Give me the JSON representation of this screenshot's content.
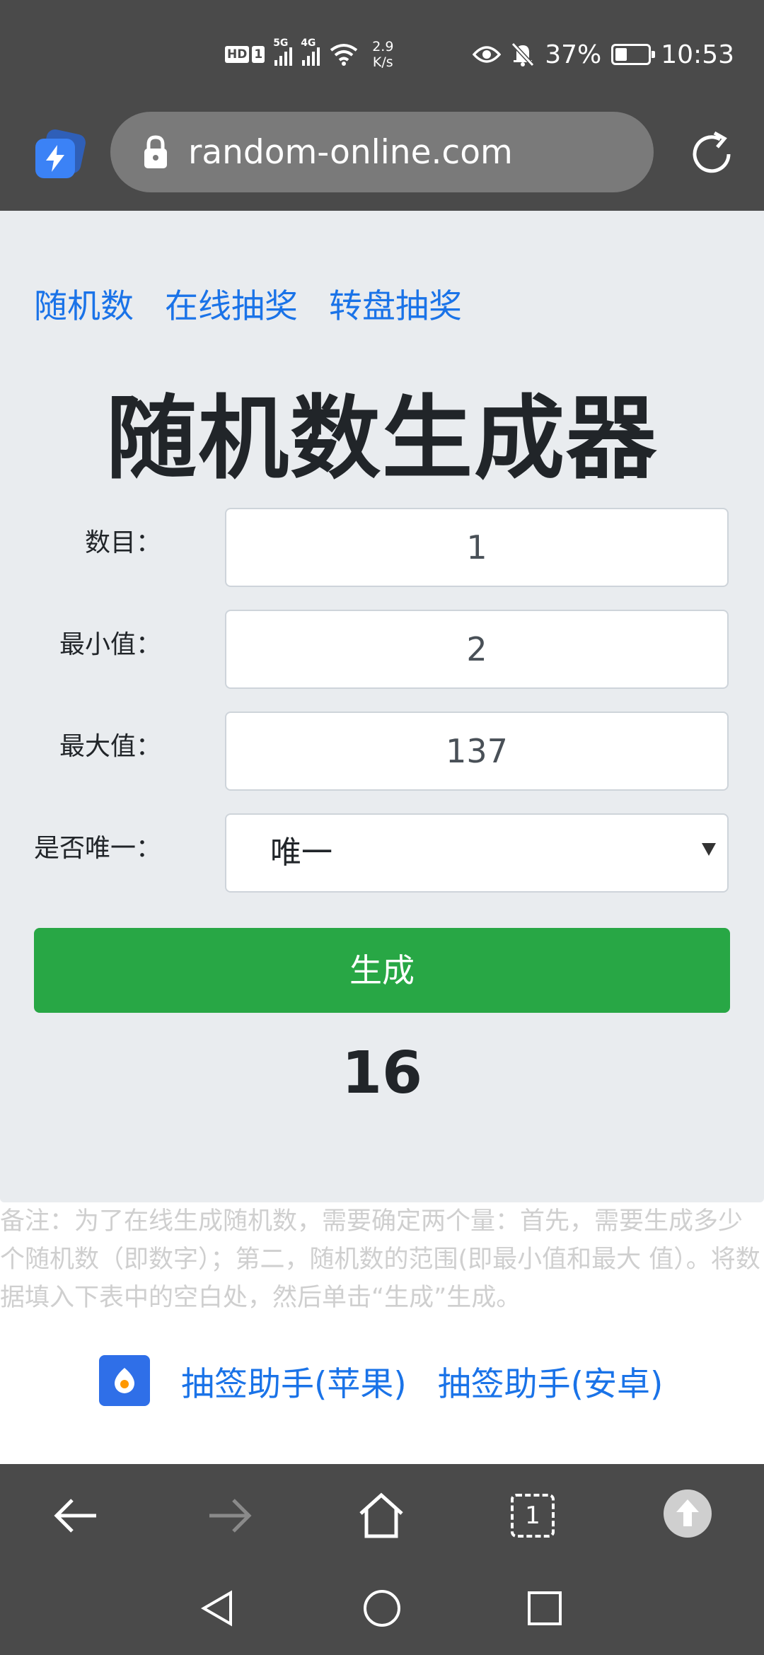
{
  "status_bar": {
    "hd_label": "HD",
    "sim_label": "1",
    "signal1_tag": "5G",
    "signal2_tag": "4G",
    "speed_value": "2.9",
    "speed_unit": "K/s",
    "battery": "37%",
    "time": "10:53"
  },
  "browser": {
    "url": "random-online.com"
  },
  "nav": {
    "links": [
      "随机数",
      "在线抽奖",
      "转盘抽奖"
    ]
  },
  "page": {
    "title": "随机数生成器",
    "fields": {
      "count_label": "数目：",
      "count_value": "1",
      "min_label": "最小值：",
      "min_value": "2",
      "max_label": "最大值：",
      "max_value": "137",
      "unique_label": "是否唯一：",
      "unique_value": "唯一"
    },
    "generate_label": "生成",
    "result": "16",
    "note": "备注：为了在线生成随机数，需要确定两个量：首先，需要生成多少个随机数（即数字）；第二，随机数的范围(即最小值和最大 值）。将数据填入下表中的空白处，然后单击“生成”生成。"
  },
  "helper": {
    "ios_label": "抽签助手(苹果)",
    "android_label": "抽签助手(安卓)"
  },
  "toolbar": {
    "tabs_count": "1"
  }
}
